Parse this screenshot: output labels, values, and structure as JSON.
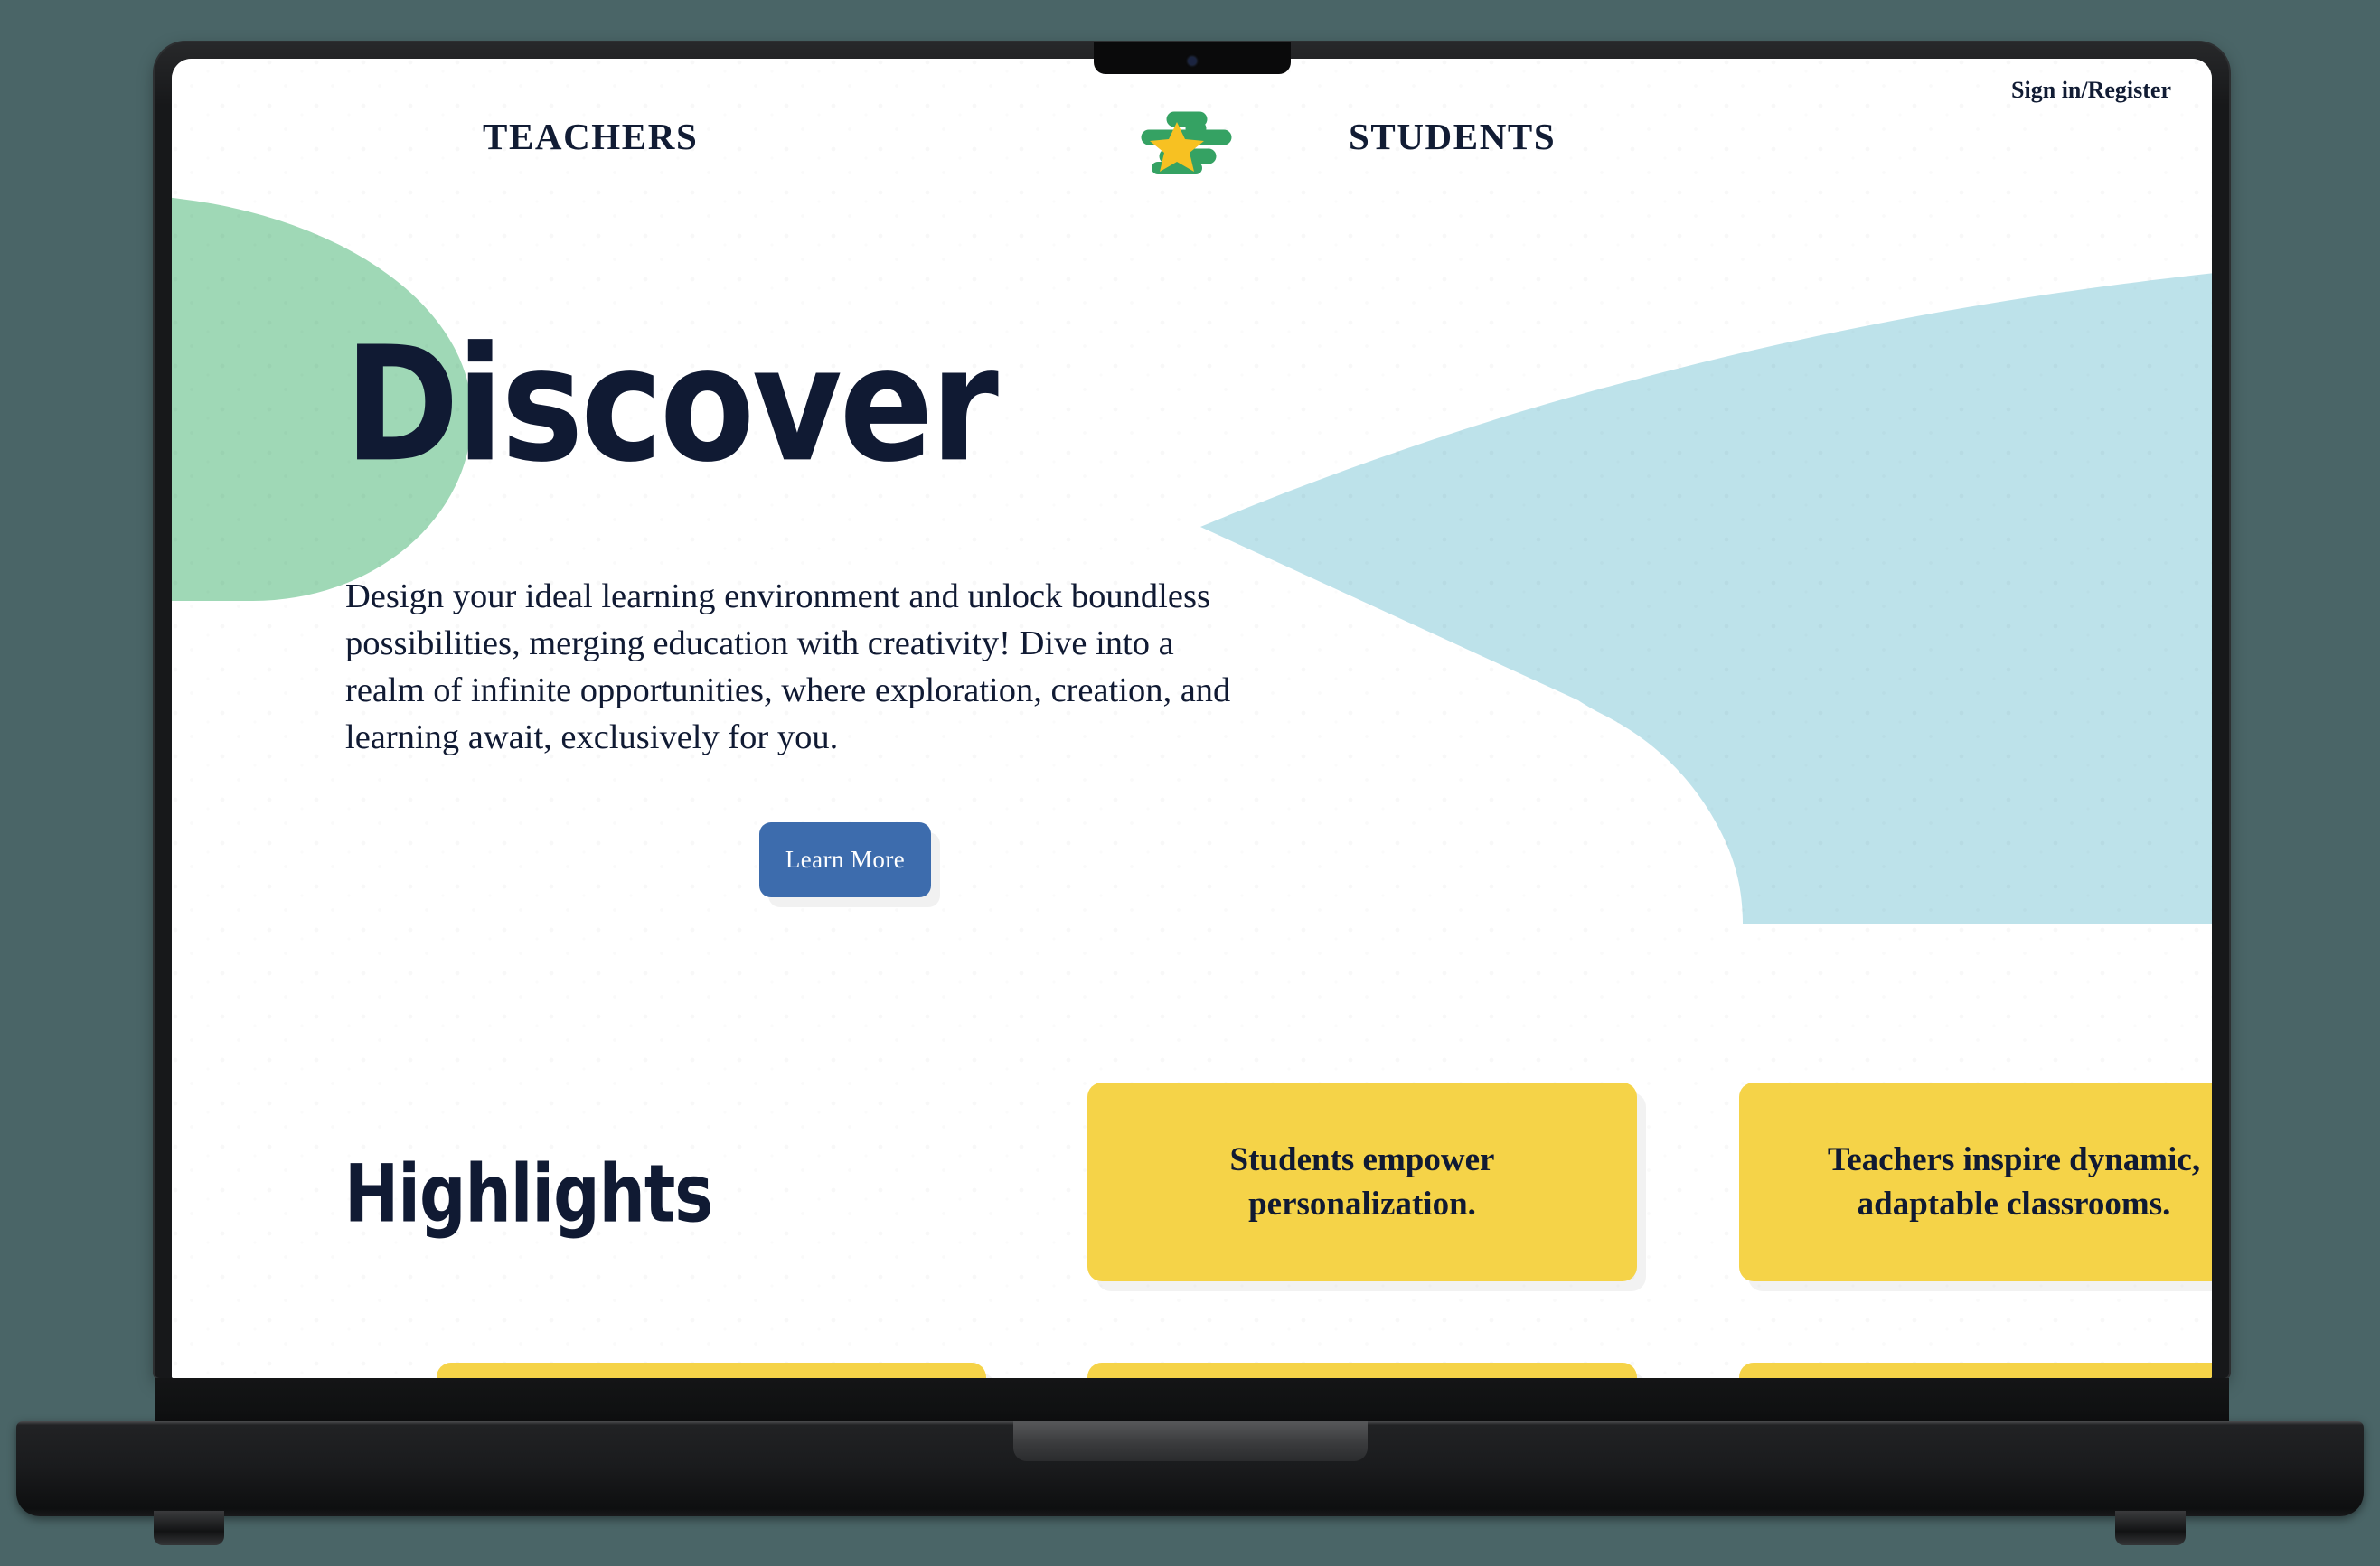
{
  "device": {
    "type": "laptop-mockup",
    "scene_background_color": "#4a6567",
    "frame_color": "#17181a"
  },
  "theme": {
    "ink": "#101a33",
    "accent_blue": "#3d6cad",
    "card_yellow": "#f5d348",
    "blob_green": "#9fd8b6",
    "blob_blue": "#bde2ea",
    "logo_green": "#35a263",
    "logo_yellow": "#f7c122",
    "page_background": "#ffffff"
  },
  "header": {
    "nav_teachers": "TEACHERS",
    "nav_students": "STUDENTS",
    "signin": "Sign in/Register",
    "logo_name": "star-swoosh-logo"
  },
  "hero": {
    "title": "Discover",
    "paragraph": "Design your ideal learning environment and unlock boundless possibilities, merging education with creativity! Dive into a realm of infinite opportunities, where exploration, creation, and learning await, exclusively for you.",
    "cta_label": "Learn More"
  },
  "highlights": {
    "title": "Highlights",
    "cards": [
      {
        "text": "Students empower personalization."
      },
      {
        "text": "Teachers inspire dynamic, adaptable classrooms."
      },
      {
        "text": ""
      },
      {
        "text": ""
      },
      {
        "text": ""
      }
    ]
  }
}
